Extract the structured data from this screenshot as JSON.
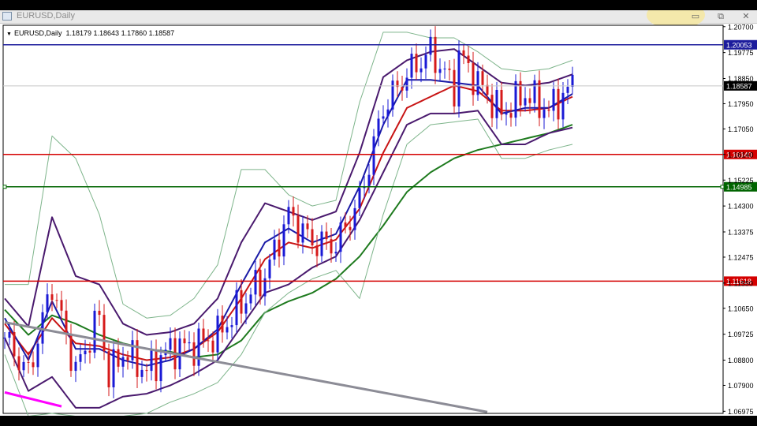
{
  "window": {
    "title": "EURUSD,Daily",
    "buttons": {
      "minimize": "▭",
      "maximize": "⧉",
      "close": "✕"
    },
    "icon": "chart-window-icon"
  },
  "header": {
    "symbol": "EURUSD,Daily",
    "open": "1.18179",
    "high": "1.18643",
    "low": "1.17860",
    "close": "1.18587"
  },
  "chart_data": {
    "type": "line",
    "title": "EURUSD,Daily",
    "ylim": [
      1.069,
      1.2075
    ],
    "y_ticks": [
      "1.20700",
      "1.19775",
      "1.18850",
      "1.17950",
      "1.17050",
      "1.16140",
      "1.15225",
      "1.14300",
      "1.13375",
      "1.12475",
      "1.11550",
      "1.10650",
      "1.09725",
      "1.08800",
      "1.07900",
      "1.06975"
    ],
    "x_range": [
      0,
      120
    ],
    "current_price": {
      "value": 1.18587,
      "label": "1.18587",
      "color": "#000000"
    },
    "levels": [
      {
        "value": 1.20053,
        "label": "1.20053",
        "color": "#1c1c9c"
      },
      {
        "value": 1.1614,
        "label": "1.16140",
        "color": "#d40000"
      },
      {
        "value": 1.14985,
        "label": "1.14985",
        "color": "#006400"
      },
      {
        "value": 1.11618,
        "label": "1.11618",
        "color": "#d40000"
      }
    ],
    "trendlines": [
      {
        "color": "#8c8c96",
        "points": [
          [
            0,
            1.1015
          ],
          [
            102,
            1.0695
          ]
        ]
      },
      {
        "color": "#ff00ff",
        "points": [
          [
            0,
            1.0765
          ],
          [
            12,
            1.0715
          ]
        ]
      }
    ],
    "close_series": {
      "x": [
        0,
        5,
        10,
        15,
        20,
        22,
        25,
        30,
        35,
        40,
        45,
        50,
        55,
        60,
        65,
        70,
        75,
        80,
        85,
        90,
        95,
        96,
        100,
        105,
        110,
        115,
        120
      ],
      "y": [
        1.096,
        1.083,
        1.115,
        1.084,
        1.104,
        1.082,
        1.091,
        1.084,
        1.092,
        1.093,
        1.097,
        1.108,
        1.118,
        1.14,
        1.13,
        1.129,
        1.145,
        1.178,
        1.19,
        1.198,
        1.185,
        1.197,
        1.187,
        1.176,
        1.183,
        1.177,
        1.186
      ]
    },
    "series": [
      {
        "name": "",
        "color": "#c81414",
        "x": [
          0,
          5,
          10,
          15,
          20,
          25,
          30,
          35,
          40,
          45,
          50,
          55,
          60,
          65,
          70,
          75,
          80,
          85,
          90,
          95,
          100,
          105,
          110,
          115,
          120
        ],
        "y": [
          1.101,
          1.09,
          1.103,
          1.094,
          1.093,
          1.09,
          1.088,
          1.089,
          1.092,
          1.098,
          1.11,
          1.124,
          1.13,
          1.128,
          1.131,
          1.142,
          1.162,
          1.178,
          1.182,
          1.186,
          1.184,
          1.177,
          1.177,
          1.178,
          1.182
        ]
      },
      {
        "name": "",
        "color": "#1e7a1e",
        "x": [
          0,
          5,
          10,
          15,
          20,
          25,
          30,
          35,
          40,
          45,
          50,
          55,
          60,
          65,
          70,
          75,
          80,
          85,
          90,
          95,
          100,
          105,
          110,
          115,
          120
        ],
        "y": [
          1.106,
          1.097,
          1.104,
          1.101,
          1.097,
          1.094,
          1.092,
          1.091,
          1.089,
          1.09,
          1.095,
          1.105,
          1.109,
          1.112,
          1.117,
          1.125,
          1.136,
          1.148,
          1.155,
          1.16,
          1.163,
          1.165,
          1.167,
          1.169,
          1.172
        ]
      },
      {
        "name": "",
        "color": "#1a1aa6",
        "x": [
          0,
          5,
          10,
          15,
          20,
          25,
          30,
          35,
          40,
          45,
          50,
          55,
          60,
          65,
          70,
          75,
          80,
          85,
          90,
          95,
          100,
          105,
          110,
          115,
          120
        ],
        "y": [
          1.103,
          1.088,
          1.109,
          1.092,
          1.092,
          1.088,
          1.086,
          1.088,
          1.092,
          1.099,
          1.115,
          1.13,
          1.135,
          1.13,
          1.133,
          1.15,
          1.172,
          1.188,
          1.188,
          1.187,
          1.186,
          1.176,
          1.178,
          1.178,
          1.183
        ]
      },
      {
        "name": "",
        "color": "#4a1a6e",
        "x": [
          0,
          5,
          10,
          15,
          20,
          25,
          30,
          35,
          40,
          45,
          50,
          55,
          60,
          65,
          70,
          75,
          80,
          85,
          90,
          95,
          100,
          105,
          110,
          115,
          120
        ],
        "y": [
          1.11,
          1.1,
          1.139,
          1.118,
          1.115,
          1.101,
          1.097,
          1.098,
          1.101,
          1.11,
          1.13,
          1.144,
          1.141,
          1.138,
          1.141,
          1.162,
          1.189,
          1.195,
          1.198,
          1.199,
          1.193,
          1.187,
          1.186,
          1.187,
          1.19
        ]
      },
      {
        "name": "",
        "color": "#4a1a6e",
        "x": [
          0,
          5,
          10,
          15,
          20,
          25,
          30,
          35,
          40,
          45,
          50,
          55,
          60,
          65,
          70,
          75,
          80,
          85,
          90,
          95,
          100,
          105,
          110,
          115,
          120
        ],
        "y": [
          1.096,
          1.077,
          1.082,
          1.071,
          1.071,
          1.075,
          1.076,
          1.079,
          1.083,
          1.088,
          1.1,
          1.112,
          1.115,
          1.121,
          1.125,
          1.138,
          1.155,
          1.172,
          1.176,
          1.176,
          1.177,
          1.165,
          1.165,
          1.169,
          1.171
        ]
      },
      {
        "name": "",
        "color": "#7db48a",
        "x": [
          0,
          5,
          10,
          15,
          20,
          25,
          30,
          35,
          40,
          45,
          50,
          55,
          60,
          65,
          70,
          75,
          80,
          85,
          90,
          95,
          100,
          105,
          110,
          115,
          120
        ],
        "y": [
          1.115,
          1.115,
          1.168,
          1.16,
          1.14,
          1.108,
          1.103,
          1.104,
          1.11,
          1.122,
          1.156,
          1.156,
          1.147,
          1.143,
          1.145,
          1.18,
          1.205,
          1.205,
          1.203,
          1.203,
          1.198,
          1.192,
          1.191,
          1.192,
          1.195
        ]
      },
      {
        "name": "",
        "color": "#7db48a",
        "x": [
          0,
          5,
          10,
          15,
          20,
          25,
          30,
          35,
          40,
          45,
          50,
          55,
          60,
          65,
          70,
          75,
          80,
          85,
          90,
          95,
          100,
          105,
          110,
          115,
          120
        ],
        "y": [
          1.09,
          1.068,
          1.069,
          1.068,
          1.066,
          1.068,
          1.069,
          1.073,
          1.076,
          1.08,
          1.09,
          1.105,
          1.112,
          1.117,
          1.12,
          1.11,
          1.14,
          1.165,
          1.172,
          1.173,
          1.174,
          1.16,
          1.16,
          1.163,
          1.165
        ]
      }
    ]
  }
}
